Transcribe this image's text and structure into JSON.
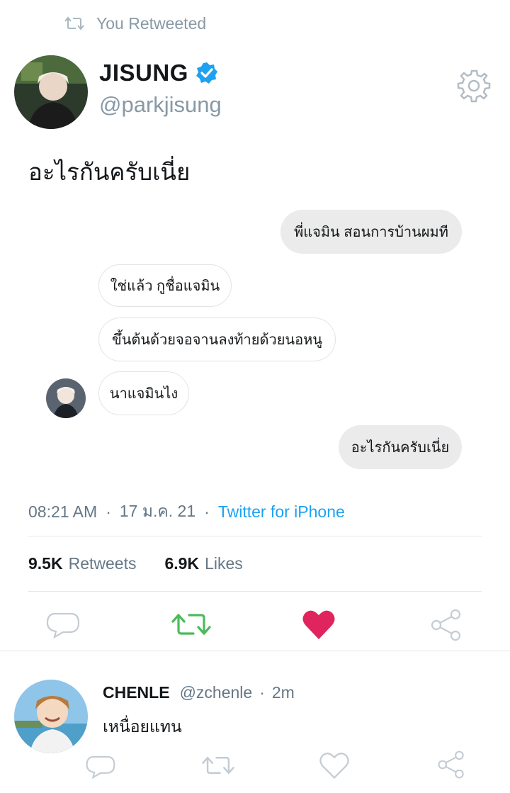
{
  "banner": {
    "icon": "retweet-icon",
    "text": "You Retweeted"
  },
  "tweet": {
    "author_name": "JISUNG",
    "author_handle": "@parkjisung",
    "verified_icon": "verified-badge-icon",
    "settings_icon": "gear-icon",
    "text": "อะไรกันครับเนี่ย",
    "chat": [
      {
        "side": "sent",
        "text": "พี่แจมิน สอนการบ้านผมที"
      },
      {
        "side": "recv",
        "text": "ใช่แล้ว กูชื่อแจมิน"
      },
      {
        "side": "recv",
        "text": "ขึ้นต้นด้วยจอจานลงท้ายด้วยนอหนู"
      },
      {
        "side": "recv",
        "text": "นาแจมินไง"
      },
      {
        "side": "sent",
        "text": "อะไรกันครับเนี่ย"
      }
    ],
    "time": "08:21 AM",
    "date": "17 ม.ค. 21",
    "separator": "·",
    "client": "Twitter for iPhone",
    "retweets_count": "9.5K",
    "retweets_label": "Retweets",
    "likes_count": "6.9K",
    "likes_label": "Likes",
    "actions": [
      "reply-icon",
      "retweet-icon",
      "like-icon",
      "share-icon"
    ],
    "colors": {
      "retweet_active": "#4cba5a",
      "like_active": "#e0245e",
      "link": "#1da1f2",
      "muted": "#8899a6"
    }
  },
  "reply": {
    "author_name": "CHENLE",
    "author_handle": "@zchenle",
    "separator": "·",
    "time": "2m",
    "text": "เหนื่อยแทน",
    "actions": [
      "reply-icon",
      "retweet-icon",
      "like-icon",
      "share-icon"
    ]
  }
}
